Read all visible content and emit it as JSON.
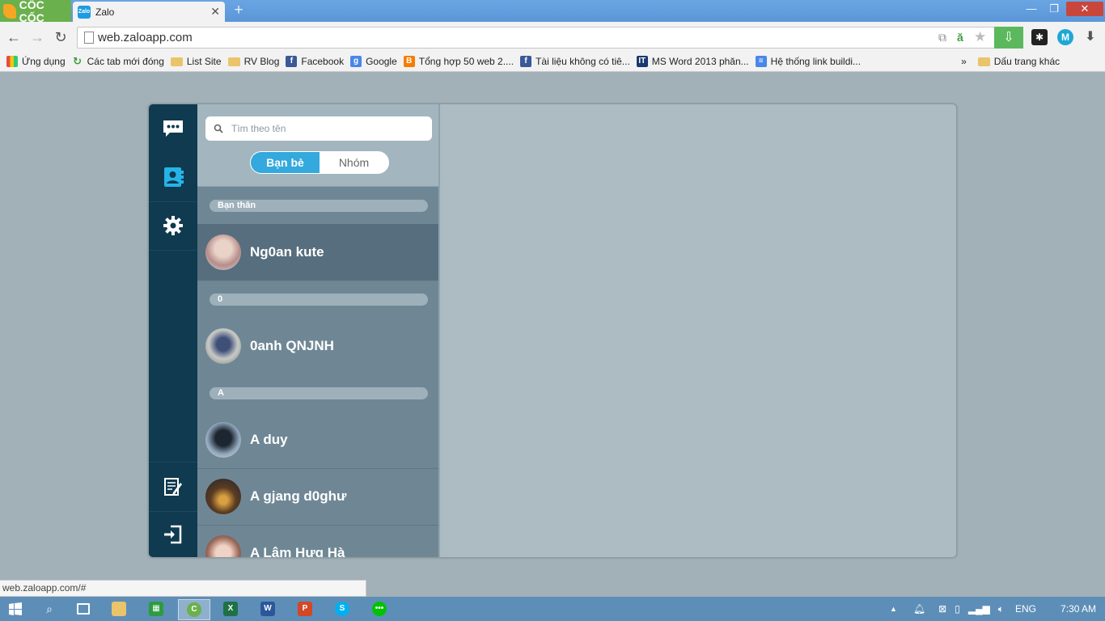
{
  "browser": {
    "brand": "CỐC CỐC",
    "tab": {
      "favicon_text": "Zalo",
      "title": "Zalo"
    },
    "url": "web.zaloapp.com",
    "bookmarks": [
      {
        "label": "Ứng dụng",
        "icon": "apps-grid-icon"
      },
      {
        "label": "Các tab mới đóng",
        "icon": "recent-tabs-icon"
      },
      {
        "label": "List Site",
        "icon": "folder-icon"
      },
      {
        "label": "RV Blog",
        "icon": "folder-icon"
      },
      {
        "label": "Facebook",
        "icon": "facebook-icon"
      },
      {
        "label": "Google",
        "icon": "google-icon"
      },
      {
        "label": "Tổng hợp 50 web 2....",
        "icon": "blogger-icon"
      },
      {
        "label": "Tài liệu không có tiê...",
        "icon": "facebook-icon"
      },
      {
        "label": "MS Word 2013 phăn...",
        "icon": "it-icon"
      },
      {
        "label": "Hệ thống link buildi...",
        "icon": "docs-icon"
      }
    ],
    "bookmarks_more": "»",
    "other_bookmarks": "Dấu trang khác",
    "status_url": "web.zaloapp.com/#"
  },
  "zalo": {
    "search_placeholder": "Tìm theo tên",
    "tabs": {
      "friends": "Bạn bè",
      "groups": "Nhóm",
      "active": "friends"
    },
    "sections": [
      {
        "header": "Bạn thân",
        "contacts": [
          {
            "name": "Ng0an kute",
            "selected": true
          }
        ]
      },
      {
        "header": "0",
        "contacts": [
          {
            "name": "0anh QNJNH"
          }
        ]
      },
      {
        "header": "A",
        "contacts": [
          {
            "name": "A duy"
          },
          {
            "name": "A gjang d0ghư"
          },
          {
            "name": "A Lâm Hưg Hà"
          }
        ]
      }
    ]
  },
  "taskbar": {
    "language": "ENG",
    "time": "7:30 AM"
  }
}
